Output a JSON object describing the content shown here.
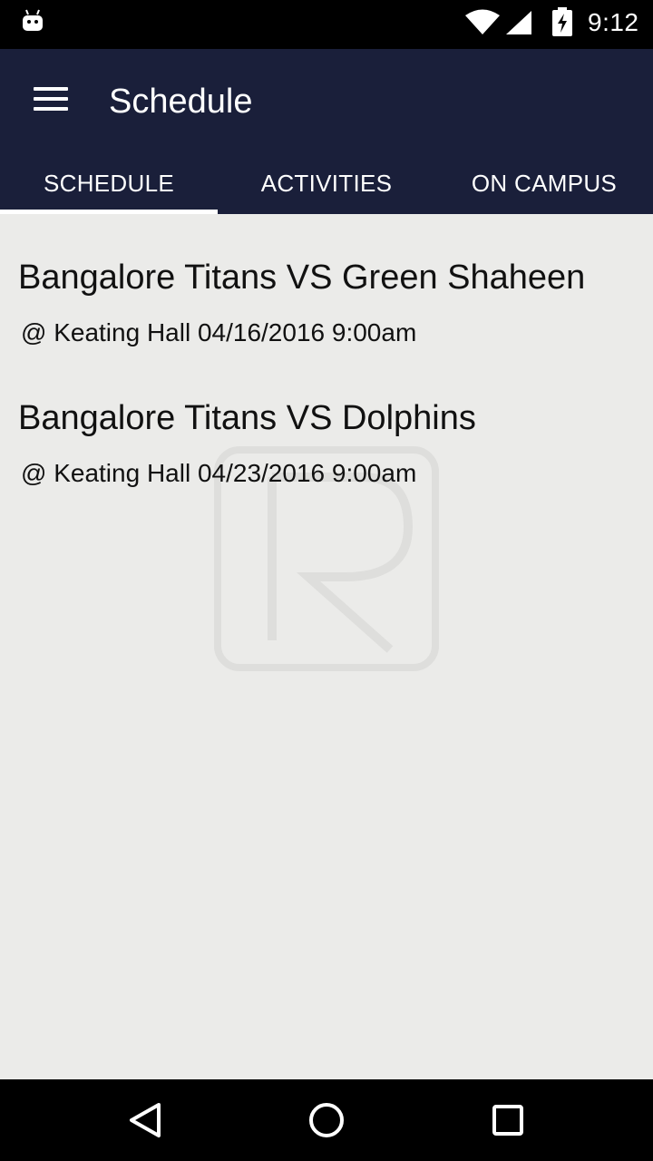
{
  "status_bar": {
    "time": "9:12",
    "icons": [
      "android-notification-icon",
      "wifi-icon",
      "signal-icon",
      "battery-charging-icon"
    ]
  },
  "app_bar": {
    "title": "Schedule",
    "menu_icon": "hamburger-menu-icon"
  },
  "tabs": [
    {
      "label": "SCHEDULE",
      "active": true
    },
    {
      "label": "ACTIVITIES",
      "active": false
    },
    {
      "label": "ON CAMPUS",
      "active": false
    }
  ],
  "games": [
    {
      "title": "Bangalore Titans VS Green Shaheen",
      "detail": "@ Keating Hall 04/16/2016 9:00am"
    },
    {
      "title": "Bangalore Titans VS Dolphins",
      "detail": "@ Keating Hall 04/23/2016 9:00am"
    }
  ],
  "nav_bar": {
    "buttons": [
      "back-icon",
      "home-icon",
      "recents-icon"
    ]
  },
  "colors": {
    "app_bar": "#1a1f3a",
    "content_bg": "#ebebe9",
    "text": "#111111",
    "tab_indicator": "#ffffff"
  }
}
